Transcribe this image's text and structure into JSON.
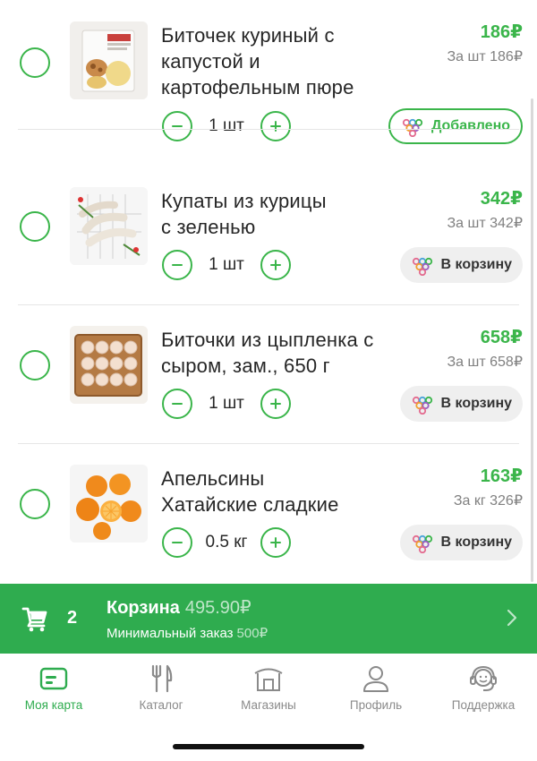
{
  "items": [
    {
      "title_line1": "Биточек куриный с",
      "title_line2": "капустой и",
      "title_line3": "картофельным пюре",
      "price": "186₽",
      "unit_price": "За шт 186₽",
      "qty": "1 шт",
      "button_label": "Добавлено",
      "button_state": "added"
    },
    {
      "title_line1": "Купаты из курицы",
      "title_line2": "с зеленью",
      "price": "342₽",
      "unit_price": "За шт 342₽",
      "qty": "1 шт",
      "button_label": "В корзину",
      "button_state": "default"
    },
    {
      "title_line1": "Биточки из цыпленка с",
      "title_line2": "сыром, зам., 650 г",
      "price": "658₽",
      "unit_price": "За шт 658₽",
      "qty": "1 шт",
      "button_label": "В корзину",
      "button_state": "default"
    },
    {
      "title_line1": "Апельсины",
      "title_line2": "Хатайские сладкие",
      "price": "163₽",
      "unit_price": "За кг 326₽",
      "qty": "0.5 кг",
      "button_label": "В корзину",
      "button_state": "default"
    }
  ],
  "cart": {
    "count": "2",
    "label": "Корзина",
    "total": "495.90₽",
    "min_label": "Минимальный заказ",
    "min_value": "500₽"
  },
  "tabs": [
    {
      "label": "Моя карта",
      "icon": "card-icon",
      "active": true
    },
    {
      "label": "Каталог",
      "icon": "cutlery-icon",
      "active": false
    },
    {
      "label": "Магазины",
      "icon": "store-icon",
      "active": false
    },
    {
      "label": "Профиль",
      "icon": "person-icon",
      "active": false
    },
    {
      "label": "Поддержка",
      "icon": "headset-icon",
      "active": false
    }
  ],
  "colors": {
    "accent": "#3ab54a",
    "cart_bar": "#2fac4f",
    "muted_text": "#8a8a8a"
  }
}
